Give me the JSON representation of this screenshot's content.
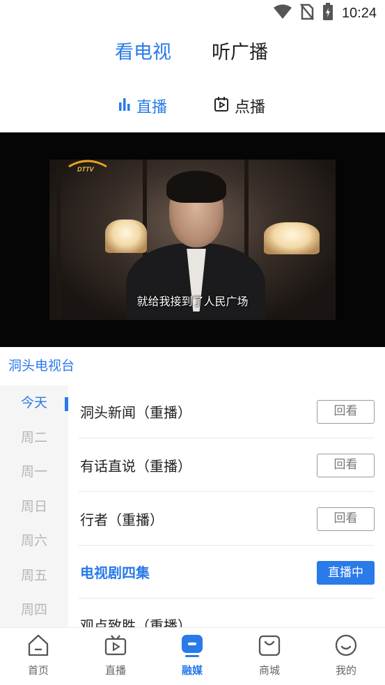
{
  "status_bar": {
    "time": "10:24",
    "icons": [
      "wifi-icon",
      "no-sim-icon",
      "battery-charging-icon"
    ]
  },
  "mode_tabs": {
    "tv": "看电视",
    "radio": "听广播"
  },
  "sub_tabs": {
    "live": "直播",
    "vod": "点播"
  },
  "video": {
    "channel_logo": "DTTV",
    "subtitle": "就给我接到了人民广场"
  },
  "station_name": "洞头电视台",
  "days": [
    "今天",
    "周二",
    "周一",
    "周日",
    "周六",
    "周五",
    "周四"
  ],
  "programs": [
    {
      "title": "洞头新闻（重播）",
      "action": "回看",
      "status": "replay"
    },
    {
      "title": "有话直说（重播）",
      "action": "回看",
      "status": "replay"
    },
    {
      "title": "行者（重播）",
      "action": "回看",
      "status": "replay"
    },
    {
      "title": "电视剧四集",
      "action": "直播中",
      "status": "live"
    },
    {
      "title": "观点致胜（重播）",
      "action": "",
      "status": "upcoming"
    }
  ],
  "bottom_nav": [
    "首页",
    "直播",
    "融媒",
    "商城",
    "我的"
  ],
  "colors": {
    "accent": "#2a7ae9",
    "text": "#222222",
    "muted": "#b6b6b6",
    "sidebar_bg": "#f5f5f5"
  }
}
